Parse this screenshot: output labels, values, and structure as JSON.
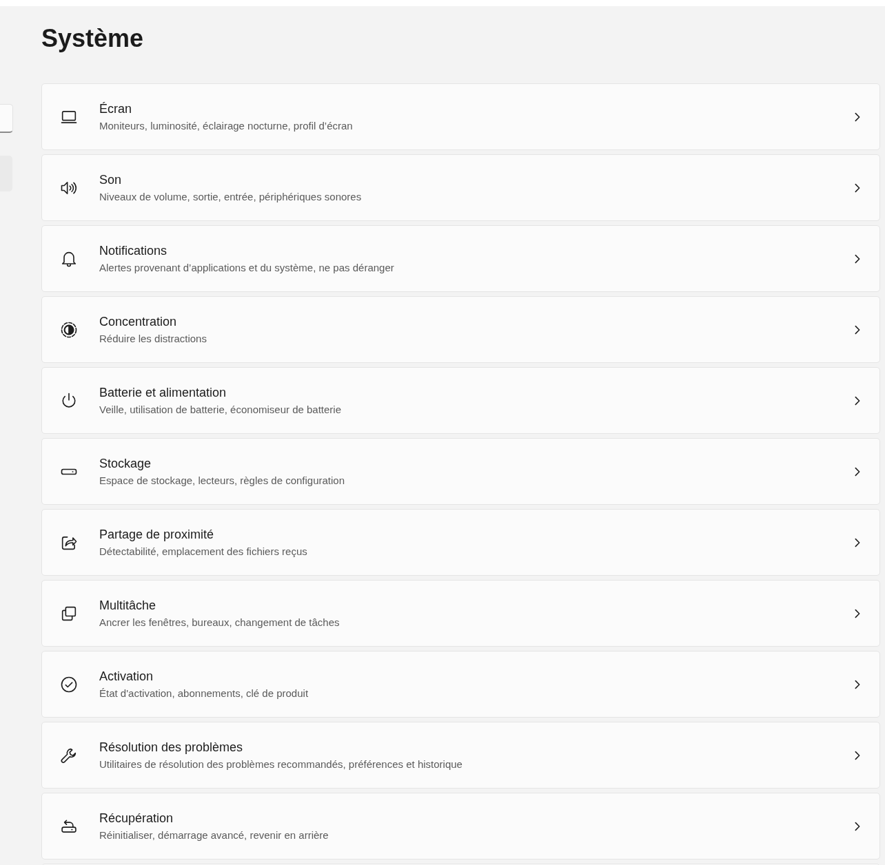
{
  "page": {
    "title": "Système"
  },
  "items": [
    {
      "kind": "display",
      "title": "Écran",
      "subtitle": "Moniteurs, luminosité, éclairage nocturne, profil d’écran"
    },
    {
      "kind": "sound",
      "title": "Son",
      "subtitle": "Niveaux de volume, sortie, entrée, périphériques sonores"
    },
    {
      "kind": "notifications",
      "title": "Notifications",
      "subtitle": "Alertes provenant d’applications et du système, ne pas déranger"
    },
    {
      "kind": "focus",
      "title": "Concentration",
      "subtitle": "Réduire les distractions"
    },
    {
      "kind": "power",
      "title": "Batterie et alimentation",
      "subtitle": "Veille, utilisation de batterie, économiseur de batterie"
    },
    {
      "kind": "storage",
      "title": "Stockage",
      "subtitle": "Espace de stockage, lecteurs, règles de configuration"
    },
    {
      "kind": "share",
      "title": "Partage de proximité",
      "subtitle": "Détectabilité, emplacement des fichiers reçus"
    },
    {
      "kind": "multitask",
      "title": "Multitâche",
      "subtitle": "Ancrer les fenêtres, bureaux, changement de tâches"
    },
    {
      "kind": "activation",
      "title": "Activation",
      "subtitle": "État d'activation, abonnements, clé de produit"
    },
    {
      "kind": "troubleshoot",
      "title": "Résolution des problèmes",
      "subtitle": "Utilitaires de résolution des problèmes recommandés, préférences et historique"
    },
    {
      "kind": "recovery",
      "title": "Récupération",
      "subtitle": "Réinitialiser, démarrage avancé, revenir en arrière"
    }
  ]
}
